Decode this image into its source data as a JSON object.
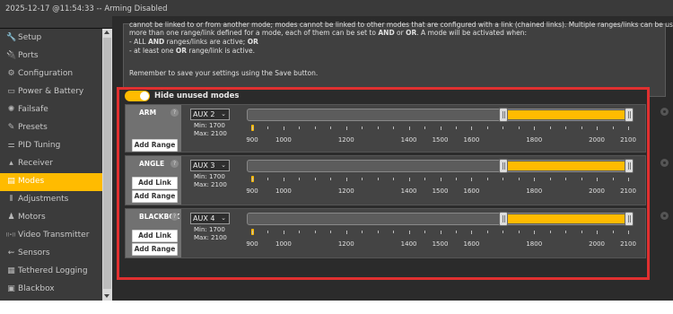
{
  "window": {
    "title": "2025-12-17 @11:54:33 -- Arming Disabled"
  },
  "sidebar": {
    "items": [
      {
        "label": "Setup",
        "icon": "wrench-icon",
        "glyph": "🔧",
        "active": false
      },
      {
        "label": "Ports",
        "icon": "plug-icon",
        "glyph": "🔌",
        "active": false
      },
      {
        "label": "Configuration",
        "icon": "gear-icon",
        "glyph": "⚙",
        "active": false
      },
      {
        "label": "Power & Battery",
        "icon": "battery-icon",
        "glyph": "▭",
        "active": false
      },
      {
        "label": "Failsafe",
        "icon": "failsafe-icon",
        "glyph": "✺",
        "active": false
      },
      {
        "label": "Presets",
        "icon": "presets-icon",
        "glyph": "✎",
        "active": false
      },
      {
        "label": "PID Tuning",
        "icon": "sliders-icon",
        "glyph": "⚌",
        "active": false
      },
      {
        "label": "Receiver",
        "icon": "receiver-icon",
        "glyph": "▴",
        "active": false
      },
      {
        "label": "Modes",
        "icon": "modes-icon",
        "glyph": "▤",
        "active": true
      },
      {
        "label": "Adjustments",
        "icon": "adjustments-icon",
        "glyph": "⫴",
        "active": false
      },
      {
        "label": "Motors",
        "icon": "motors-icon",
        "glyph": "♟",
        "active": false
      },
      {
        "label": "Video Transmitter",
        "icon": "vtx-icon",
        "glyph": "((•))",
        "active": false
      },
      {
        "label": "Sensors",
        "icon": "sensors-icon",
        "glyph": "⇜",
        "active": false
      },
      {
        "label": "Tethered Logging",
        "icon": "logging-icon",
        "glyph": "▦",
        "active": false
      },
      {
        "label": "Blackbox",
        "icon": "blackbox-icon",
        "glyph": "▣",
        "active": false
      }
    ]
  },
  "info": {
    "lines": [
      "cannot be linked to or from another mode; modes cannot be linked to other modes that are configured with a link (chained links). Multiple ranges/links can be used to activate any mode; if there",
      "more than one range/link defined for a mode, each of them can be set to AND or OR. A mode will be activated when:",
      "- ALL AND ranges/links are active; OR",
      "- at least one OR range/link is active.",
      "",
      "Remember to save your settings using the Save button."
    ]
  },
  "toggle": {
    "label": "Hide unused modes",
    "on": true
  },
  "scale": {
    "ticks": [
      900,
      1000,
      1200,
      1400,
      1500,
      1600,
      1800,
      2000,
      2100
    ],
    "minor": [
      950,
      1050,
      1100,
      1150,
      1250,
      1300,
      1350,
      1450,
      1550,
      1650,
      1700,
      1750,
      1850,
      1900,
      1950,
      2050
    ]
  },
  "modes": [
    {
      "name": "ARM",
      "channel": "AUX 2",
      "min_label": "Min: 1700",
      "max_label": "Max: 2100",
      "range": [
        1700,
        2100
      ],
      "live": 900,
      "buttons": [
        "Add Range"
      ]
    },
    {
      "name": "ANGLE",
      "channel": "AUX 3",
      "min_label": "Min: 1700",
      "max_label": "Max: 2100",
      "range": [
        1700,
        2100
      ],
      "live": 900,
      "buttons": [
        "Add Link",
        "Add Range"
      ]
    },
    {
      "name": "BLACKBOX",
      "channel": "AUX 4",
      "min_label": "Min: 1700",
      "max_label": "Max: 2100",
      "range": [
        1700,
        2100
      ],
      "live": 900,
      "buttons": [
        "Add Link",
        "Add Range"
      ]
    }
  ]
}
